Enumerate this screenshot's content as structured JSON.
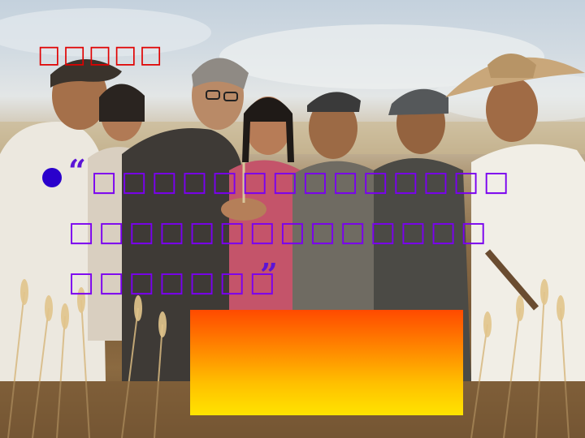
{
  "slide": {
    "title": "□□□□□",
    "quote": {
      "open_mark": "“",
      "close_mark": "”",
      "lines": [
        "□□□□□□□□□□□□□□",
        "□□□□□□□□□□□□□□",
        "□□□□□□□"
      ]
    },
    "colors": {
      "title": "#e00000",
      "quote_text": "#7a00f0",
      "bullet": "#2a00cc",
      "box_top": "#ff4a00",
      "box_bottom": "#ffe400"
    },
    "photo": {
      "subject": "group of people in a wheat field"
    }
  }
}
